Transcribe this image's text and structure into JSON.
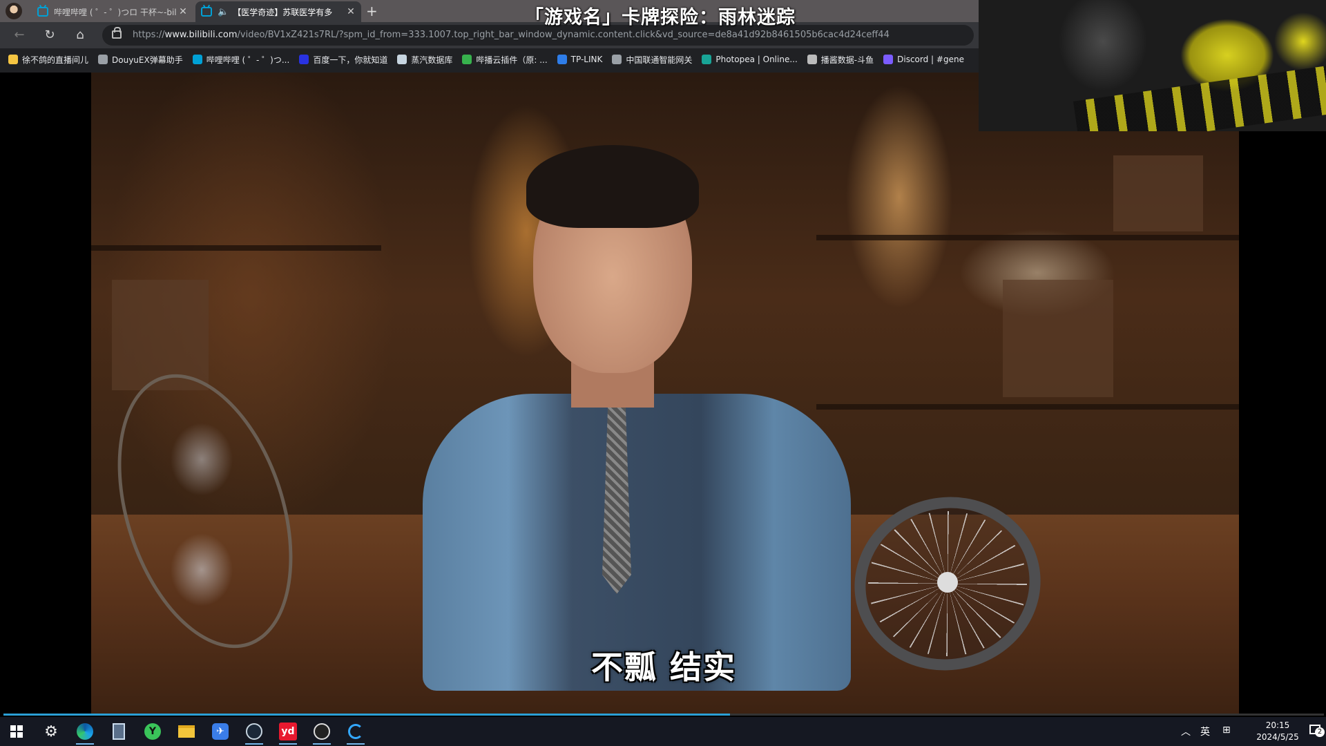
{
  "browser": {
    "tabs": [
      {
        "title": "哔哩哔哩 ( ゜- ゜)つロ 干杯~-bilibili",
        "active": false
      },
      {
        "title": "【医学奇迹】苏联医学有多",
        "active": true
      }
    ],
    "new_tab_label": "+",
    "url": {
      "scheme": "https://",
      "host": "www.bilibili.com",
      "path": "/video/BV1xZ421s7RL/?spm_id_from=333.1007.top_right_bar_window_dynamic.content.click&vd_source=de8a41d92b8461505b6cac4d24ceff44"
    },
    "bookmarks": [
      {
        "label": "徐不鸽的直播间儿",
        "color": "#f5c542"
      },
      {
        "label": "DouyuEX弹幕助手",
        "color": "#9aa0a6"
      },
      {
        "label": "哔哩哔哩 ( ゜- ゜)つ...",
        "color": "#00a1d6"
      },
      {
        "label": "百度一下，你就知道",
        "color": "#2932e1"
      },
      {
        "label": "蒸汽数据库",
        "color": "#c7d5e0"
      },
      {
        "label": "哔播云插件（原: ...",
        "color": "#37b24d"
      },
      {
        "label": "TP-LINK",
        "color": "#2e7de9"
      },
      {
        "label": "中国联通智能网关",
        "color": "#9aa0a6"
      },
      {
        "label": "Photopea | Online...",
        "color": "#18a497"
      },
      {
        "label": "播酱数据-斗鱼",
        "color": "#bbbbbb"
      },
      {
        "label": "Discord | #gene",
        "color": "#7b5cff"
      }
    ]
  },
  "overlay": {
    "title": "「游戏名」卡牌探险：雨林迷踪"
  },
  "video": {
    "subtitle": "不瓢 结实",
    "progress": 0.55
  },
  "taskbar": {
    "apps": [
      "windows-start",
      "settings",
      "edge",
      "calculator",
      "green-app",
      "file-explorer",
      "bird-app",
      "steam",
      "youdao",
      "obs",
      "loop-app"
    ],
    "tray": {
      "lang": "英",
      "time": "20:15",
      "date": "2024/5/25",
      "notifications": "2"
    }
  },
  "colors": {
    "tab_bar": "#5a5658",
    "toolbar": "#35363a",
    "bilibili_blue": "#00a1d6",
    "taskbar": "#151822"
  }
}
